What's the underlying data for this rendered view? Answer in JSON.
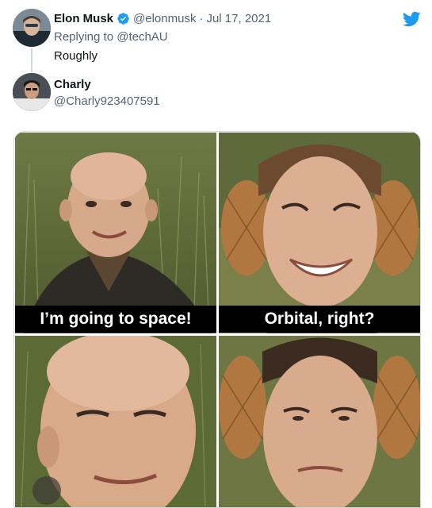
{
  "parent_tweet": {
    "author_name": "Elon Musk",
    "author_handle": "@elonmusk",
    "separator": "·",
    "date": "Jul 17, 2021",
    "replying_label": "Replying to",
    "replying_handle": "@techAU",
    "text": "Roughly"
  },
  "reply": {
    "author_name": "Charly",
    "author_handle": "@Charly923407591"
  },
  "meme": {
    "captions": [
      "I’m going to space!",
      "Orbital, right?"
    ]
  },
  "colors": {
    "twitter_blue": "#1d9bf0",
    "text_primary": "#0f1419",
    "text_secondary": "#536471",
    "caption_bg": "#000000",
    "caption_text": "#ffffff"
  },
  "icons": {
    "verified": "verified-badge-icon",
    "brand": "twitter-bird-icon"
  }
}
